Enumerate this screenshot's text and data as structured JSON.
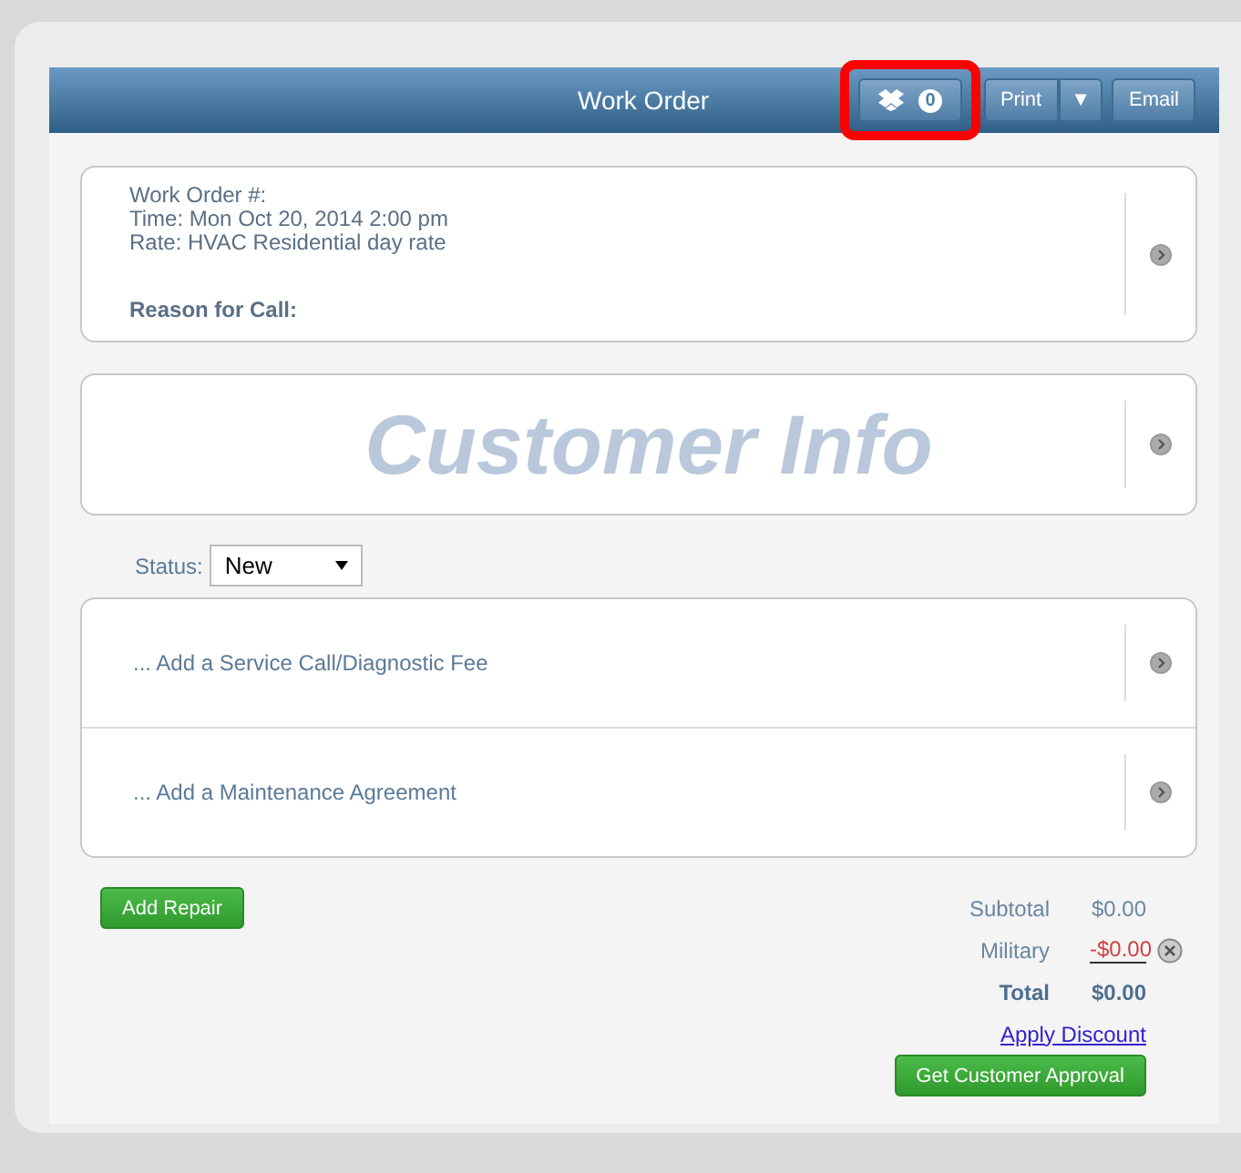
{
  "header": {
    "title": "Work Order",
    "badge_count": "0",
    "buttons": [
      {
        "label": "Print",
        "kind": "split"
      },
      {
        "label": "▼",
        "kind": "caret"
      },
      {
        "label": "Email",
        "kind": "plain"
      }
    ]
  },
  "work_order": {
    "lines": [
      "Work Order #:",
      "Time: Mon Oct 20, 2014 2:00 pm",
      "Rate: HVAC Residential day rate"
    ],
    "reason_label": "Reason for Call:"
  },
  "customer_info": {
    "placeholder": "Customer Info"
  },
  "status": {
    "label": "Status:",
    "value": "New"
  },
  "add_items": [
    "... Add a Service Call/Diagnostic Fee",
    "... Add a Maintenance Agreement"
  ],
  "add_repair": "Add Repair",
  "totals": [
    {
      "kind": "plain",
      "label": "Subtotal",
      "value": "$0.00"
    },
    {
      "kind": "discount",
      "label": "Military",
      "value": "-$0.00"
    },
    {
      "kind": "total",
      "label": "Total",
      "value": "$0.00"
    }
  ],
  "apply_discount": "Apply Discount",
  "approval": "Get Customer Approval"
}
